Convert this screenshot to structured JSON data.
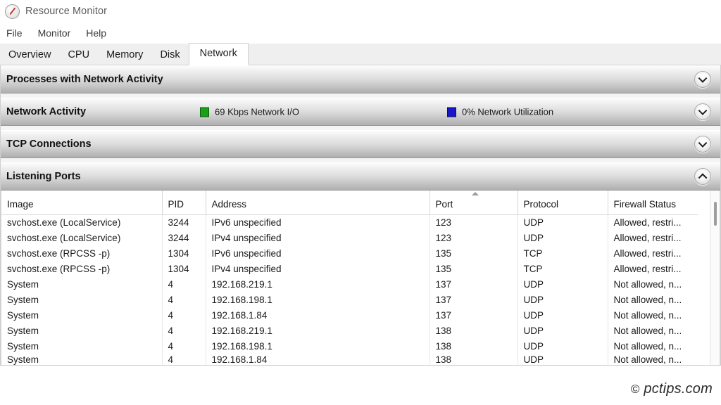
{
  "window": {
    "title": "Resource Monitor",
    "app_icon": "resource-monitor-gauge-icon"
  },
  "menu": {
    "items": [
      {
        "label": "File"
      },
      {
        "label": "Monitor"
      },
      {
        "label": "Help"
      }
    ]
  },
  "tabs": {
    "selected": "Network",
    "items": [
      {
        "label": "Overview"
      },
      {
        "label": "CPU"
      },
      {
        "label": "Memory"
      },
      {
        "label": "Disk"
      },
      {
        "label": "Network"
      }
    ]
  },
  "sections": [
    {
      "title": "Processes with Network Activity",
      "expanded": false,
      "chevron": "chevron-down-icon"
    },
    {
      "title": "Network Activity",
      "expanded": false,
      "chevron": "chevron-down-icon",
      "legend": [
        {
          "swatch_color": "#18a018",
          "label": "69 Kbps Network I/O"
        },
        {
          "swatch_color": "#1717c7",
          "label": "0% Network Utilization"
        }
      ]
    },
    {
      "title": "TCP Connections",
      "expanded": false,
      "chevron": "chevron-down-icon"
    },
    {
      "title": "Listening Ports",
      "expanded": true,
      "chevron": "chevron-up-icon"
    }
  ],
  "listening_ports": {
    "sorted_column": "Port",
    "sort_direction": "ascending",
    "columns": [
      "Image",
      "PID",
      "Address",
      "Port",
      "Protocol",
      "Firewall Status"
    ],
    "rows": [
      [
        "svchost.exe (LocalService)",
        "3244",
        "IPv6 unspecified",
        "123",
        "UDP",
        "Allowed, restri..."
      ],
      [
        "svchost.exe (LocalService)",
        "3244",
        "IPv4 unspecified",
        "123",
        "UDP",
        "Allowed, restri..."
      ],
      [
        "svchost.exe (RPCSS -p)",
        "1304",
        "IPv6 unspecified",
        "135",
        "TCP",
        "Allowed, restri..."
      ],
      [
        "svchost.exe (RPCSS -p)",
        "1304",
        "IPv4 unspecified",
        "135",
        "TCP",
        "Allowed, restri..."
      ],
      [
        "System",
        "4",
        "192.168.219.1",
        "137",
        "UDP",
        "Not allowed, n..."
      ],
      [
        "System",
        "4",
        "192.168.198.1",
        "137",
        "UDP",
        "Not allowed, n..."
      ],
      [
        "System",
        "4",
        "192.168.1.84",
        "137",
        "UDP",
        "Not allowed, n..."
      ],
      [
        "System",
        "4",
        "192.168.219.1",
        "138",
        "UDP",
        "Not allowed, n..."
      ],
      [
        "System",
        "4",
        "192.168.198.1",
        "138",
        "UDP",
        "Not allowed, n..."
      ],
      [
        "System",
        "4",
        "192.168.1.84",
        "138",
        "UDP",
        "Not allowed, n..."
      ]
    ]
  },
  "watermark": {
    "symbol": "©",
    "text": "pctips.com"
  }
}
